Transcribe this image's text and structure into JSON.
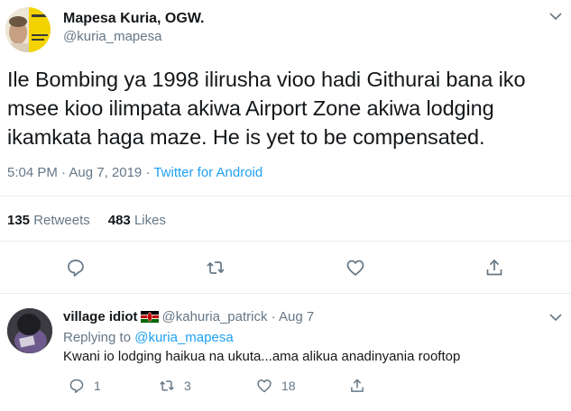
{
  "tweet": {
    "name": "Mapesa Kuria, OGW.",
    "handle": "@kuria_mapesa",
    "text_lines": [
      "Ile Bombing ya 1998 ilirusha vioo hadi Githurai bana iko",
      "msee kioo ilimpata akiwa Airport Zone akiwa lodging",
      "ikamkata haga maze. He is yet to be compensated."
    ],
    "time_date": "5:04 PM · Aug 7, 2019 · ",
    "source": "Twitter for Android",
    "retweets_count": "135",
    "retweets_label": "Retweets",
    "likes_count": "483",
    "likes_label": "Likes",
    "icons": [
      "reply-icon",
      "retweet-icon",
      "like-icon",
      "share-icon"
    ]
  },
  "reply": {
    "name": "village idiot",
    "handle": "@kahuria_patrick",
    "dot": "·",
    "date": "Aug 7",
    "replying_prefix": "Replying to ",
    "replying_to": "@kuria_mapesa",
    "text": "Kwani io lodging haikua na ukuta...ama alikua anadinyania rooftop",
    "reply_count": "1",
    "retweet_count": "3",
    "like_count": "18"
  },
  "colors": {
    "text": "#14171a",
    "secondary": "#657786",
    "accent": "#1da1f2",
    "divider": "#e6ecf0"
  }
}
